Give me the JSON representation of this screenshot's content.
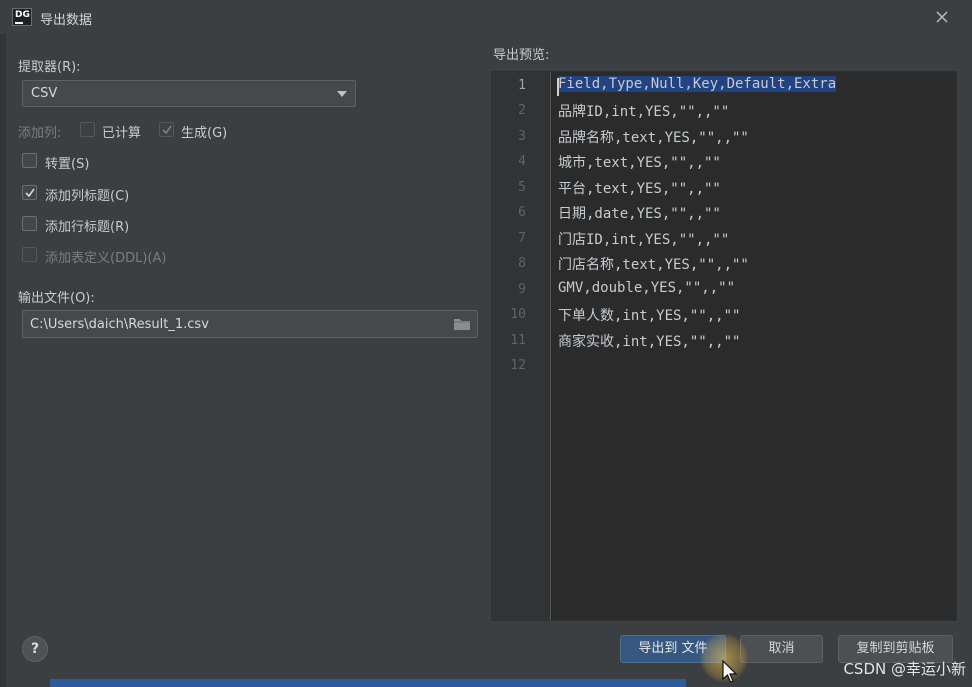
{
  "window": {
    "title": "导出数据",
    "app_logo": "DG"
  },
  "extractor": {
    "label": "提取器(R):",
    "value": "CSV"
  },
  "add_columns": {
    "label": "添加列:",
    "computed_label": "已计算",
    "generated_label": "生成(G)"
  },
  "options": {
    "transpose": "转置(S)",
    "add_column_header": "添加列标题(C)",
    "add_row_header": "添加行标题(R)",
    "add_table_ddl": "添加表定义(DDL)(A)"
  },
  "output": {
    "label": "输出文件(O):",
    "path": "C:\\Users\\daich\\Result_1.csv"
  },
  "preview": {
    "label": "导出预览:",
    "line_numbers": [
      "1",
      "2",
      "3",
      "4",
      "5",
      "6",
      "7",
      "8",
      "9",
      "10",
      "11",
      "12"
    ],
    "lines": [
      "Field,Type,Null,Key,Default,Extra",
      "品牌ID,int,YES,\"\",,\"\"",
      "品牌名称,text,YES,\"\",,\"\"",
      "城市,text,YES,\"\",,\"\"",
      "平台,text,YES,\"\",,\"\"",
      "日期,date,YES,\"\",,\"\"",
      "门店ID,int,YES,\"\",,\"\"",
      "门店名称,text,YES,\"\",,\"\"",
      "GMV,double,YES,\"\",,\"\"",
      "下单人数,int,YES,\"\",,\"\"",
      "商家实收,int,YES,\"\",,\"\"",
      ""
    ]
  },
  "buttons": {
    "help": "?",
    "export": "导出到 文件",
    "cancel": "取消",
    "copy": "复制到剪贴板"
  },
  "watermark": "CSDN @幸运小新",
  "colors": {
    "accent": "#365880",
    "selection": "#214283"
  }
}
